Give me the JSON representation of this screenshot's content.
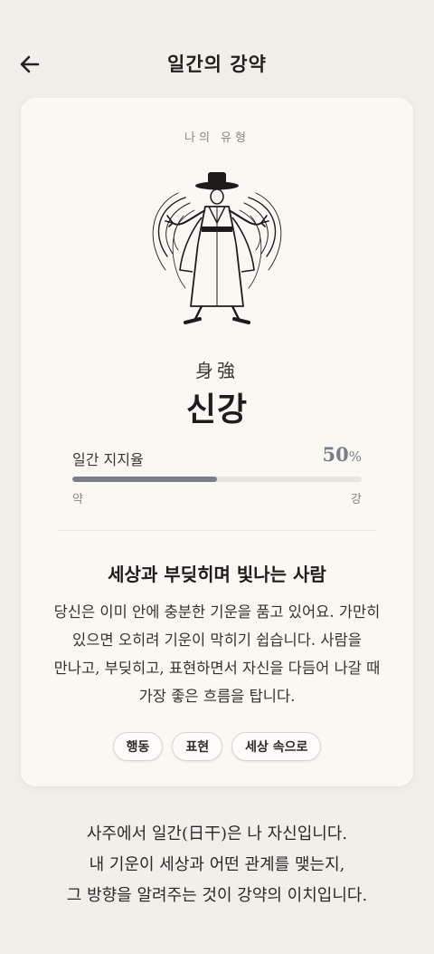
{
  "header": {
    "title": "일간의 강약"
  },
  "card": {
    "type_label": "나의 유형",
    "hanja": "身強",
    "type_name": "신강",
    "meter": {
      "label": "일간 지지율",
      "value_number": "50",
      "value_unit": "%",
      "fraction": 0.5,
      "min_label": "약",
      "max_label": "강"
    },
    "heading": "세상과 부딪히며 빛나는 사람",
    "description": "당신은 이미 안에 충분한 기운을 품고 있어요. 가만히 있으면 오히려 기운이 막히기 쉽습니다. 사람을 만나고, 부딪히고, 표현하면서 자신을 다듬어 나갈 때 가장 좋은 흐름을 탑니다.",
    "tags": [
      "행동",
      "표현",
      "세상 속으로"
    ]
  },
  "footer": {
    "line1": "사주에서 일간(日干)은 나 자신입니다.",
    "line2": "내 기운이 세상과 어떤 관계를 맺는지,",
    "line3": "그 방향을 알려주는 것이 강약의 이치입니다."
  }
}
